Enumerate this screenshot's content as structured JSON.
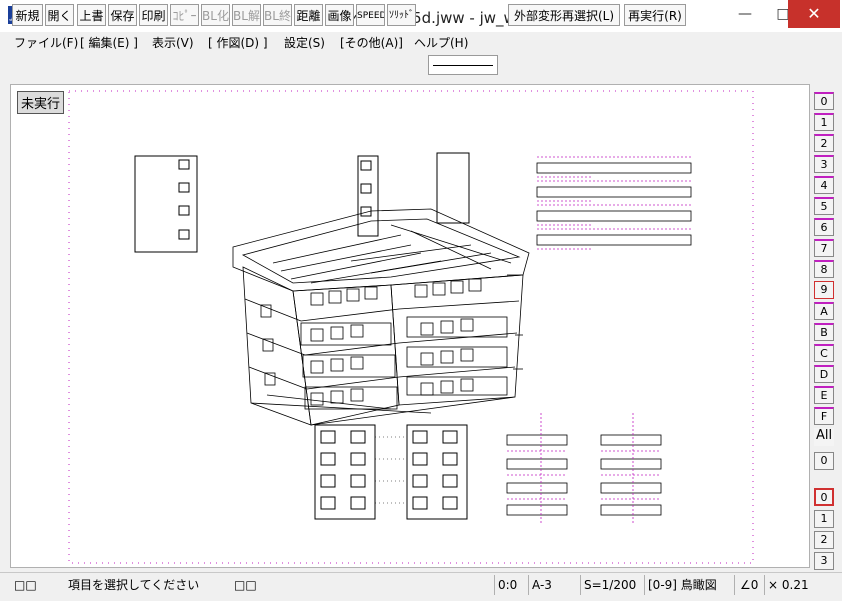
{
  "window": {
    "title": "A マンション25d.jww - jw_win",
    "icon_label": "jw",
    "minimize": "—",
    "maximize": "□",
    "close": "✕"
  },
  "menu": [
    "ファイル(F)",
    "[ 編集(E) ]",
    "表示(V)",
    "[ 作図(D) ]",
    "設定(S)",
    "[その他(A)]",
    "ヘルプ(H)"
  ],
  "toolbar": {
    "buttons": [
      {
        "label": "新規",
        "enabled": true
      },
      {
        "label": "開く",
        "enabled": true
      },
      {
        "label": "上書",
        "enabled": true
      },
      {
        "label": "保存",
        "enabled": true
      },
      {
        "label": "印刷",
        "enabled": true
      },
      {
        "label": "ｺﾋﾟｰ",
        "enabled": false
      },
      {
        "label": "BL化",
        "enabled": false
      },
      {
        "label": "BL解",
        "enabled": false
      },
      {
        "label": "BL終",
        "enabled": false
      },
      {
        "label": "距離",
        "enabled": true
      },
      {
        "label": "画像",
        "enabled": true
      },
      {
        "label": "SPEED",
        "enabled": true
      },
      {
        "label": "ｿﾘｯﾄﾞ",
        "enabled": true
      }
    ],
    "external_reselect": "外部変形再選択(L)",
    "redo": "再実行(R)"
  },
  "canvas": {
    "unexecuted_label": "未実行"
  },
  "layers": {
    "numbers": [
      "0",
      "1",
      "2",
      "3",
      "4",
      "5",
      "6",
      "7",
      "8",
      "9",
      "A",
      "B",
      "C",
      "D",
      "E",
      "F"
    ],
    "active_layer": "9",
    "all_label": "All",
    "blank_label": "0"
  },
  "groups": {
    "numbers": [
      "0",
      "1",
      "2",
      "3"
    ],
    "active_group": "0"
  },
  "status": {
    "left_boxes": "□□",
    "message": "項目を選択してください",
    "mid_boxes": "□□",
    "layer_info": "0:0",
    "paper": "A-3",
    "scale": "S=1/200",
    "layer_group": "[0-9] 鳥瞰図",
    "angle": "∠0",
    "zoom": "× 0.21"
  },
  "colors": {
    "close_button": "#c7312b",
    "layer_highlight": "#d03030",
    "layer_top_line": "#c020c0",
    "drawing_magenta": "#c020c0",
    "drawing_line": "#000000"
  }
}
